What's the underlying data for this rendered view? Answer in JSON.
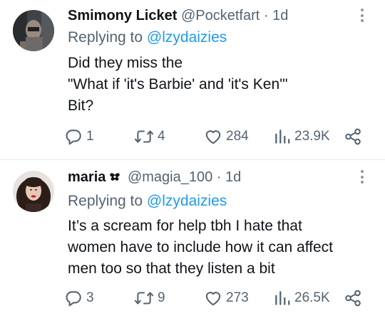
{
  "tweets": [
    {
      "display_name": "Smimony Licket",
      "handle": "@Pocketfart",
      "time": "· 1d",
      "replying_prefix": "Replying to ",
      "replying_to": "@lzydaizies",
      "text_lines": [
        "Did they miss the",
        "\"What if 'it's Barbie' and 'it's Ken'\"",
        "Bit?"
      ],
      "replies": "1",
      "retweets": "4",
      "likes": "284",
      "views": "23.9K"
    },
    {
      "display_name": "maria",
      "handle": "@magia_100",
      "time": "· 1d",
      "replying_prefix": "Replying to ",
      "replying_to": "@lzydaizies",
      "text_lines": [
        "It’s a scream for help tbh I hate that",
        "women have to include how it can affect",
        "men too so that they listen a bit"
      ],
      "replies": "3",
      "retweets": "9",
      "likes": "273",
      "views": "26.5K"
    }
  ],
  "colors": {
    "text": "#0f1419",
    "muted": "#536471",
    "link": "#1d9bf0",
    "divider": "#e6e9ec"
  },
  "icons": [
    "avatar",
    "more-icon",
    "reply-icon",
    "retweet-icon",
    "like-icon",
    "views-icon",
    "share-icon",
    "profile-badge-icon"
  ]
}
